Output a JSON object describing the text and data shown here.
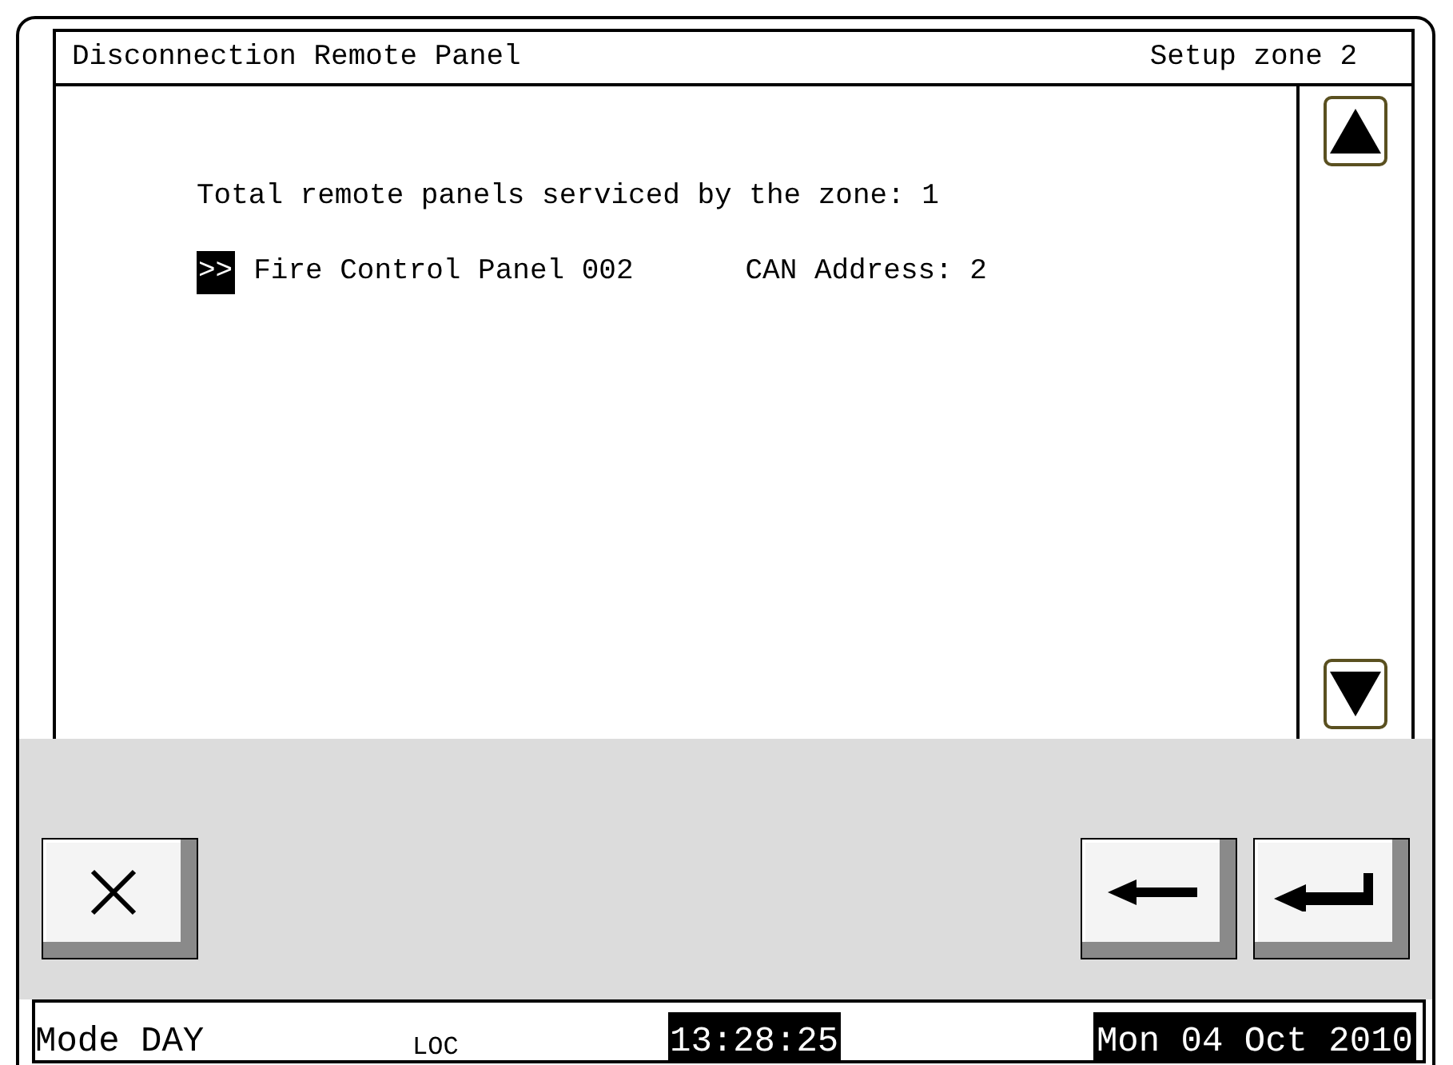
{
  "header": {
    "title": "Disconnection Remote Panel",
    "zone": "Setup zone 2"
  },
  "content": {
    "summary": "Total remote panels serviced by the zone: 1",
    "panels": [
      {
        "marker": ">>",
        "name": "Fire Control Panel 002",
        "address": "CAN Address: 2",
        "selected": true
      }
    ]
  },
  "status_bar": {
    "mode": "Mode DAY",
    "loc": "LOC",
    "time": "13:28:25",
    "date": "Mon 04 Oct 2010"
  }
}
